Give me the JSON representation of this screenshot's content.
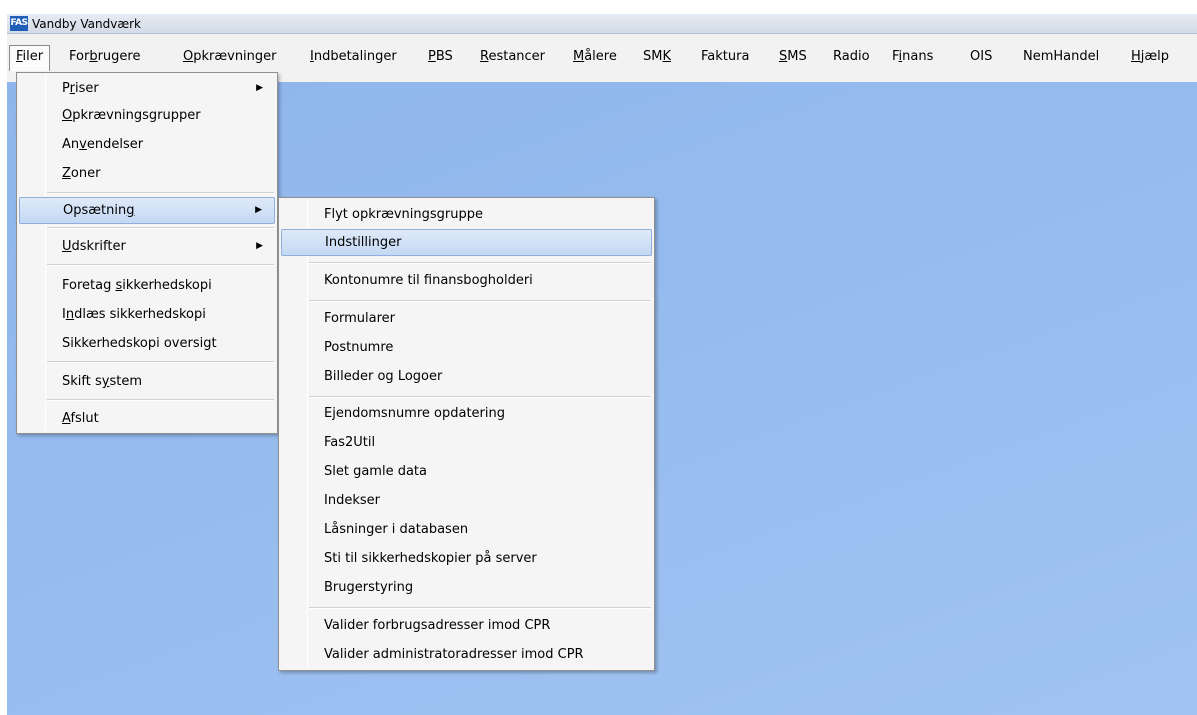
{
  "window": {
    "icon_text": "FAS",
    "title": "Vandby Vandværk"
  },
  "menubar": [
    {
      "pre": "",
      "ul": "F",
      "post": "iler"
    },
    {
      "pre": "For",
      "ul": "b",
      "post": "rugere"
    },
    {
      "pre": "",
      "ul": "O",
      "post": "pkrævninger"
    },
    {
      "pre": "",
      "ul": "I",
      "post": "ndbetalinger"
    },
    {
      "pre": "",
      "ul": "P",
      "post": "BS"
    },
    {
      "pre": "",
      "ul": "R",
      "post": "estancer"
    },
    {
      "pre": "",
      "ul": "M",
      "post": "ålere"
    },
    {
      "pre": "SM",
      "ul": "K",
      "post": ""
    },
    {
      "pre": "Faktura",
      "ul": "",
      "post": ""
    },
    {
      "pre": "",
      "ul": "S",
      "post": "MS"
    },
    {
      "pre": "Radio",
      "ul": "",
      "post": ""
    },
    {
      "pre": "F",
      "ul": "i",
      "post": "nans"
    },
    {
      "pre": "OIS",
      "ul": "",
      "post": ""
    },
    {
      "pre": "NemHandel",
      "ul": "",
      "post": ""
    },
    {
      "pre": "",
      "ul": "H",
      "post": "jælp"
    }
  ],
  "filer_menu": [
    {
      "pre": "P",
      "ul": "r",
      "post": "iser",
      "submenu": true
    },
    {
      "pre": "",
      "ul": "O",
      "post": "pkrævningsgrupper"
    },
    {
      "pre": "An",
      "ul": "v",
      "post": "endelser"
    },
    {
      "pre": "",
      "ul": "Z",
      "post": "oner"
    },
    {
      "pre": "Opsætnin",
      "ul": "g",
      "post": "",
      "submenu": true,
      "highlight": true
    },
    {
      "pre": "",
      "ul": "U",
      "post": "dskrifter",
      "submenu": true
    },
    {
      "pre": "Foretag ",
      "ul": "s",
      "post": "ikkerhedskopi"
    },
    {
      "pre": "I",
      "ul": "n",
      "post": "dlæs sikkerhedskopi"
    },
    {
      "pre": "Sikkerhedskopi oversigt",
      "ul": "",
      "post": ""
    },
    {
      "pre": "Skift s",
      "ul": "y",
      "post": "stem"
    },
    {
      "pre": "",
      "ul": "A",
      "post": "fslut"
    }
  ],
  "opsaetning_menu": [
    "Flyt opkrævningsgruppe",
    "Indstillinger",
    "Kontonumre til finansbogholderi",
    "Formularer",
    "Postnumre",
    "Billeder og Logoer",
    "Ejendomsnumre opdatering",
    "Fas2Util",
    "Slet gamle data",
    "Indekser",
    "Låsninger i databasen",
    "Sti til sikkerhedskopier på server",
    "Brugerstyring",
    "Valider forbrugsadresser imod CPR",
    "Valider administratoradresser imod CPR"
  ],
  "submenu_arrow": "▶"
}
